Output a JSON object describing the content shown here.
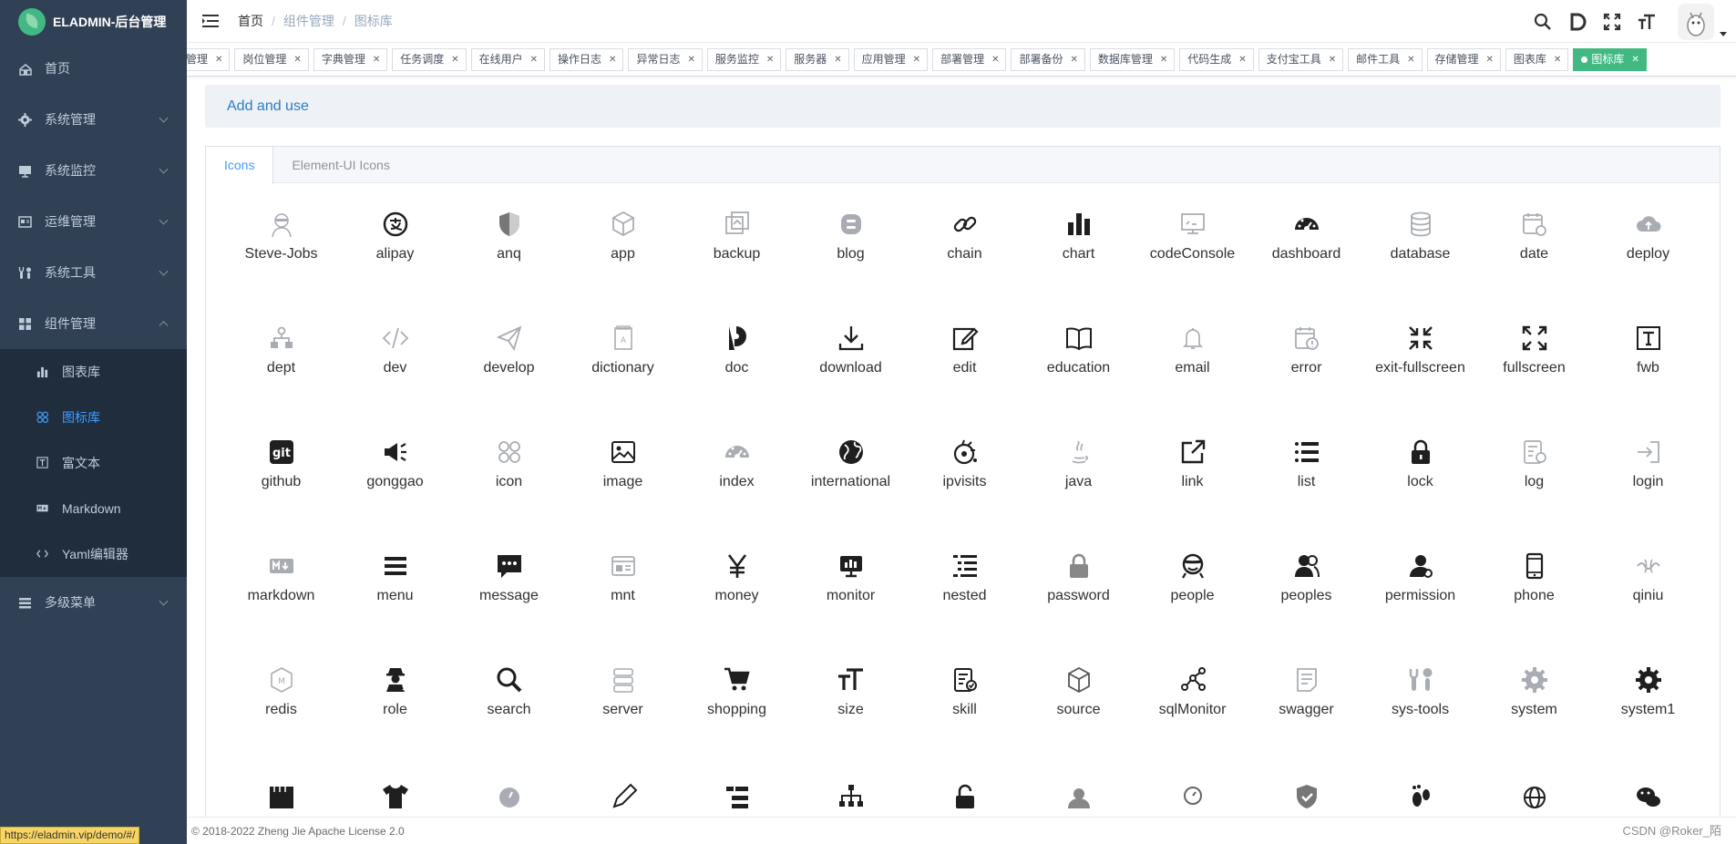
{
  "app": {
    "title": "ELADMIN-后台管理"
  },
  "sidebar": {
    "items": [
      {
        "label": "首页",
        "icon": "home-icon",
        "expandable": false
      },
      {
        "label": "系统管理",
        "icon": "gear-icon",
        "expandable": true
      },
      {
        "label": "系统监控",
        "icon": "monitor-icon",
        "expandable": true
      },
      {
        "label": "运维管理",
        "icon": "ops-icon",
        "expandable": true
      },
      {
        "label": "系统工具",
        "icon": "tools-icon",
        "expandable": true
      },
      {
        "label": "组件管理",
        "icon": "grid-icon",
        "expandable": true,
        "expanded": true
      }
    ],
    "subitems": [
      {
        "label": "图表库",
        "icon": "chart-icon",
        "active": false
      },
      {
        "label": "图标库",
        "icon": "icon-library-icon",
        "active": true
      },
      {
        "label": "富文本",
        "icon": "rich-text-icon",
        "active": false
      },
      {
        "label": "Markdown",
        "icon": "markdown-icon",
        "active": false
      },
      {
        "label": "Yaml编辑器",
        "icon": "code-icon",
        "active": false
      }
    ],
    "after": [
      {
        "label": "多级菜单",
        "icon": "menu-icon",
        "expandable": true
      }
    ]
  },
  "breadcrumb": [
    "首页",
    "组件管理",
    "图标库"
  ],
  "tags": [
    "管理",
    "岗位管理",
    "字典管理",
    "任务调度",
    "在线用户",
    "操作日志",
    "异常日志",
    "服务监控",
    "服务器",
    "应用管理",
    "部署管理",
    "部署备份",
    "数据库管理",
    "代码生成",
    "支付宝工具",
    "邮件工具",
    "存储管理",
    "图表库"
  ],
  "active_tag": "图标库",
  "main": {
    "add_use": "Add and use",
    "tabs": [
      "Icons",
      "Element-UI Icons"
    ]
  },
  "icons": [
    "Steve-Jobs",
    "alipay",
    "anq",
    "app",
    "backup",
    "blog",
    "chain",
    "chart",
    "codeConsole",
    "dashboard",
    "database",
    "date",
    "deploy",
    "dept",
    "dev",
    "develop",
    "dictionary",
    "doc",
    "download",
    "edit",
    "education",
    "email",
    "error",
    "exit-fullscreen",
    "fullscreen",
    "fwb",
    "github",
    "gonggao",
    "icon",
    "image",
    "index",
    "international",
    "ipvisits",
    "java",
    "link",
    "list",
    "lock",
    "log",
    "login",
    "markdown",
    "menu",
    "message",
    "mnt",
    "money",
    "monitor",
    "nested",
    "password",
    "people",
    "peoples",
    "permission",
    "phone",
    "qiniu",
    "redis",
    "role",
    "search",
    "server",
    "shopping",
    "size",
    "skill",
    "source",
    "sqlMonitor",
    "swagger",
    "sys-tools",
    "system",
    "system1",
    "",
    "",
    "",
    "",
    "",
    "",
    "",
    "",
    "",
    "",
    "",
    "",
    ""
  ],
  "footer": {
    "copyright": "© 2018-2022 Zheng Jie Apache License 2.0",
    "watermark": "CSDN @Roker_陌",
    "status_url": "https://eladmin.vip/demo/#/"
  }
}
